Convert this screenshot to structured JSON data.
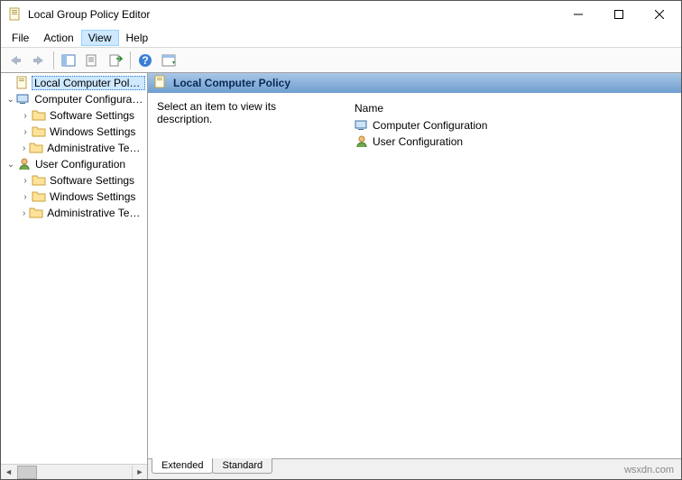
{
  "window": {
    "title": "Local Group Policy Editor"
  },
  "menus": {
    "file": "File",
    "action": "Action",
    "view": "View",
    "help": "Help"
  },
  "tree": {
    "root": "Local Computer Policy",
    "cc": "Computer Configuration",
    "cc_sw": "Software Settings",
    "cc_ws": "Windows Settings",
    "cc_at": "Administrative Templates",
    "uc": "User Configuration",
    "uc_sw": "Software Settings",
    "uc_ws": "Windows Settings",
    "uc_at": "Administrative Templates"
  },
  "details": {
    "title": "Local Computer Policy",
    "prompt": "Select an item to view its description.",
    "col_name": "Name",
    "items": {
      "cc": "Computer Configuration",
      "uc": "User Configuration"
    }
  },
  "tabs": {
    "extended": "Extended",
    "standard": "Standard"
  },
  "watermark": "wsxdn.com"
}
